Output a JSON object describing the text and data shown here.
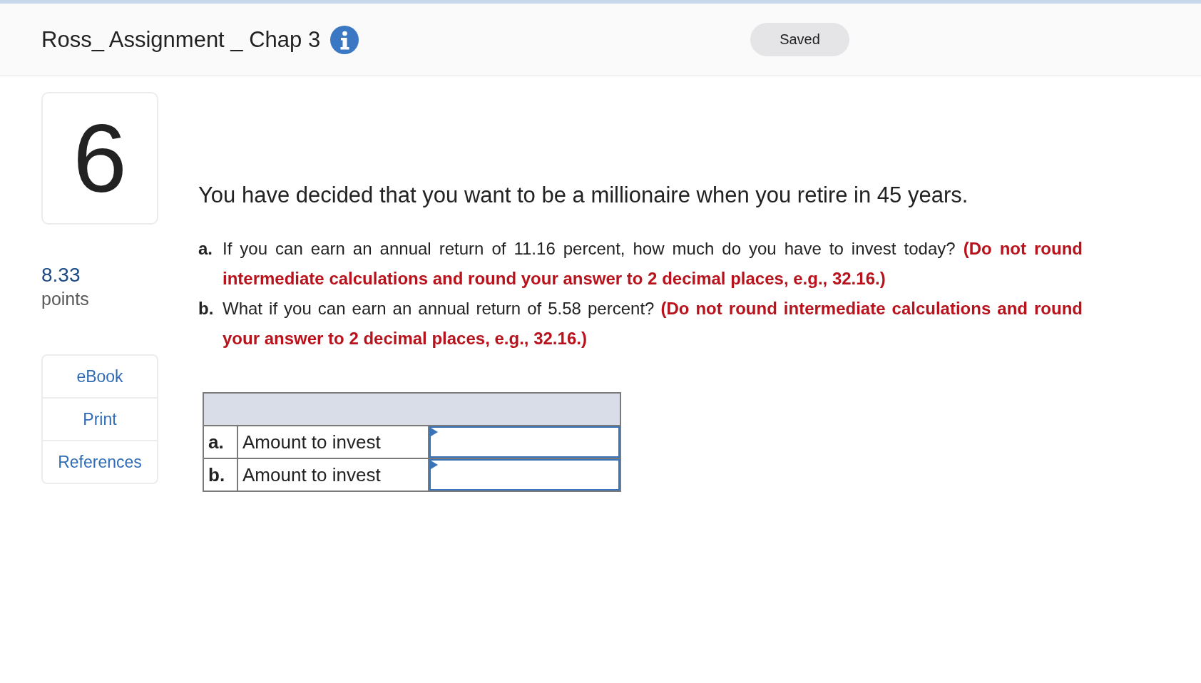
{
  "header": {
    "title": "Ross_ Assignment _ Chap 3",
    "status": "Saved"
  },
  "question": {
    "number": "6",
    "points": "8.33",
    "points_label": "points"
  },
  "resources": [
    {
      "label": "eBook"
    },
    {
      "label": "Print"
    },
    {
      "label": "References"
    }
  ],
  "stem": "You have decided that you want to be a millionaire when you retire in 45 years.",
  "parts": [
    {
      "label": "a.",
      "text": "If you can earn an annual return of 11.16 percent, how much do you have to invest today? **(Do not round intermediate calculations and round your answer to 2 decimal places, e.g., 32.16.)**"
    },
    {
      "label": "b.",
      "text": "What if you can earn an annual return of 5.58 percent? **(Do not round intermediate calculations and round your answer to 2 decimal places, e.g., 32.16.)**"
    }
  ],
  "answer_table": {
    "rows": [
      {
        "label": "a.",
        "description": "Amount to invest"
      },
      {
        "label": "b.",
        "description": "Amount to invest"
      }
    ]
  }
}
